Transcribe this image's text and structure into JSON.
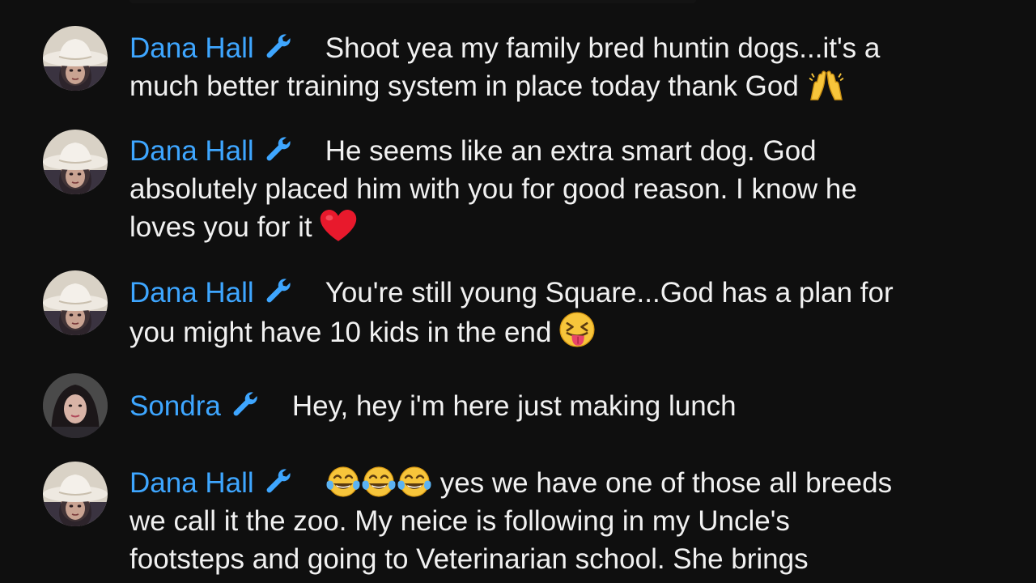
{
  "app": {
    "name": "Live chat"
  },
  "messages": [
    {
      "author": "Dana Hall",
      "author_icon": "wrench-icon",
      "avatar": "cowboy-hat-avatar",
      "lines": [
        "Shoot yea my family bred huntin dogs...it's a",
        "much better training system in place today thank God"
      ],
      "emoji": "raised-hands-emoji"
    },
    {
      "author": "Dana Hall",
      "author_icon": "wrench-icon",
      "avatar": "cowboy-hat-avatar",
      "lines": [
        "He seems like an extra smart dog. God",
        "absolutely placed him with you for good reason. I know he",
        "loves you for it"
      ],
      "emoji": "red-heart-emoji"
    },
    {
      "author": "Dana Hall",
      "author_icon": "wrench-icon",
      "avatar": "cowboy-hat-avatar",
      "lines": [
        "You're still young Square...God has a plan for",
        "you might have 10 kids in the end"
      ],
      "emoji": "tongue-out-emoji"
    },
    {
      "author": "Sondra",
      "author_icon": "wrench-icon",
      "avatar": "dark-hair-avatar",
      "lines": [
        "Hey, hey i'm here just making lunch"
      ]
    },
    {
      "author": "Dana Hall",
      "author_icon": "wrench-icon",
      "avatar": "cowboy-hat-avatar",
      "lead_emoji": "tears-of-joy-emoji-x3",
      "lines": [
        "yes we have one of those all breeds",
        "we call it the zoo. My neice is following in my Uncle's",
        "footsteps and going to Veterinarian school. She brings"
      ]
    }
  ],
  "colors": {
    "background": "#0f0f0f",
    "author": "#3ea6ff",
    "text": "#f1f1f1"
  }
}
